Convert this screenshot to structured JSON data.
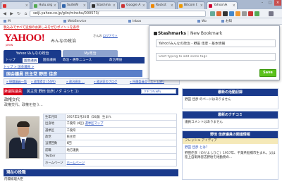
{
  "browser": {
    "tabs": [
      {
        "label": "",
        "color": "#d33"
      },
      {
        "label": "Hulu.org",
        "color": "#5a5"
      },
      {
        "label": "SuiteW",
        "color": "#36a"
      },
      {
        "label": "Stashma",
        "color": "#333"
      },
      {
        "label": "Google A",
        "color": "#c33"
      },
      {
        "label": "Rockst",
        "color": "#e80"
      },
      {
        "label": "Bitcoin t",
        "color": "#e90"
      },
      {
        "label": "Yahoo!み",
        "color": "#c03"
      }
    ],
    "address": "seiji.yahoo.co.jp/giin/minshu/000573/",
    "bookmarks": [
      "M",
      "WebService",
      "Inbox",
      "Wo",
      "お知"
    ]
  },
  "site": {
    "top_note": "税込みですべて追加のお楽しみをぜひポイントを表示",
    "logo": "YAHOO!",
    "logo_sub": "JAPAN",
    "name": "みんなの政治",
    "user_line_pre": "さんの",
    "user_link": "ログアウト",
    "tabs": [
      "Yahoo!みんなの政治",
      "My政治"
    ],
    "gnav": [
      "トップ",
      "国会議員",
      "国会議員",
      "政治・選挙ニュース",
      "政治用語"
    ],
    "breadcrumb": "トップ > 国会議員 >",
    "section_title": "国会議員   民主党   野田 佳彦",
    "links": [
      "» 現職議員一覧",
      "» 政策提言 (54件)",
      "» 政治資金 ...",
      "» 政治家のブログ",
      "» 所属委員会リスト (2件)"
    ],
    "profile_badge": "衆議院議員",
    "profile_name": "民主党  野田 佳彦(ノダ ヨシヒコ)",
    "tool_label": "クチコミ(6件)",
    "kana": "政権交代",
    "status": "政権交代、政権を担う..."
  },
  "profile_rows": [
    {
      "k": "生年月日",
      "v": "1957年5月20日（56歳）生まれ"
    },
    {
      "k": "出身地",
      "v": "千葉県 (4区)",
      "link": "選挙区マップ"
    },
    {
      "k": "選挙区",
      "v": "千葉県"
    },
    {
      "k": "政党",
      "v": "民主党"
    },
    {
      "k": "当選回数",
      "v": "6回"
    },
    {
      "k": "前職",
      "v": "地方議員"
    },
    {
      "k": "Twitter",
      "v": ""
    },
    {
      "k": "ホームページ",
      "v": "",
      "link": "ホームページ"
    }
  ],
  "current_position": {
    "title": "現在の役職",
    "lines": [
      "内閣総理大臣",
      "国会"
    ]
  },
  "right": {
    "activity_title": "最新の活動記録",
    "activity_text": "野田 佳彦 のページはありません",
    "comment_title": "最新のクチコミ",
    "comment_text": "議員コメントはありません",
    "news_title": "野田 佳彦議員の関連情報",
    "fresh_label": "フレッシュ アイディア",
    "news_items": [
      "野田 佳彦 とは？",
      "野田佳彦（のだよしひこ）1957年、千葉県船橋市生まれ。父は陸上自衛隊習志野駐屯地勤務の..."
    ]
  },
  "popup": {
    "brand": "Stashmarks",
    "title": "New Bookmark",
    "bookmark_value": "Yahoo!みんなの政治 - 野田 佳彦 - 基本情報",
    "tags_placeholder": "Start typing to add some tags",
    "save_label": "Save",
    "accent": "#5cc21b"
  }
}
